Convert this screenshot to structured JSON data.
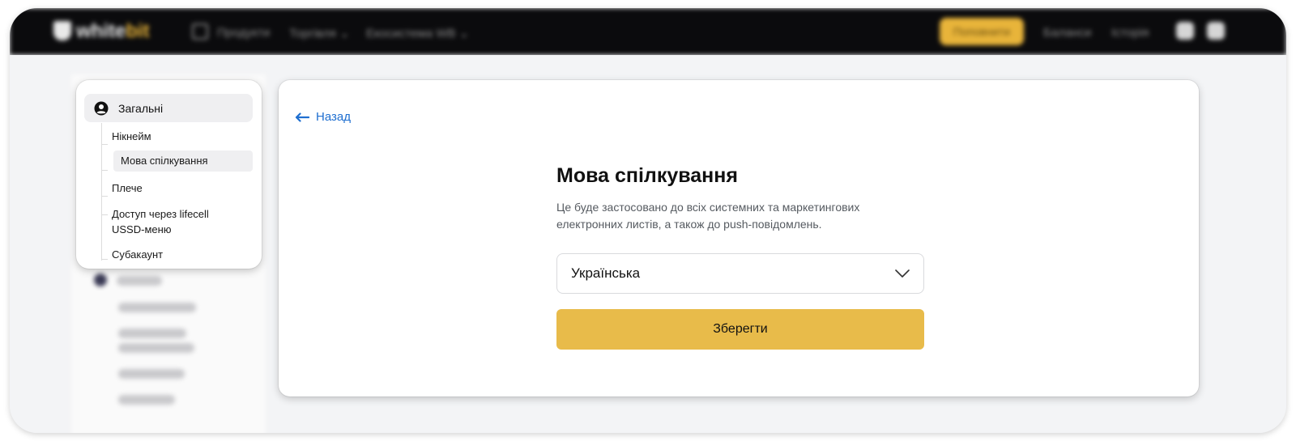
{
  "topbar": {
    "logo_text": "white",
    "logo_accent": "bit",
    "nav": [
      "Продукти",
      "Торгівля ⌄",
      "Екосистема WB ⌄"
    ],
    "cta_label": "Поповнити",
    "links": [
      "Баланси",
      "Історія"
    ]
  },
  "sidebar": {
    "section_label": "Загальні",
    "items": [
      {
        "label": "Нікнейм"
      },
      {
        "label": "Мова спілкування"
      },
      {
        "label": "Плече"
      },
      {
        "label": "Доступ через lifecell USSD-меню"
      },
      {
        "label": "Субакаунт"
      }
    ],
    "active_index": 1
  },
  "main": {
    "back_label": "Назад",
    "title": "Мова спілкування",
    "description": "Це буде застосовано до всіх системних та маркетингових електронних листів, а також до push-повідомлень.",
    "language_value": "Українська",
    "save_label": "Зберегти"
  },
  "colors": {
    "accent": "#e8bb4a",
    "link": "#1f6fd0",
    "topbar": "#0b0b0d"
  }
}
